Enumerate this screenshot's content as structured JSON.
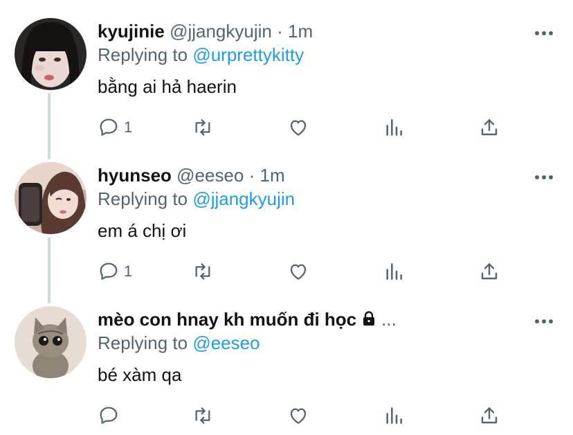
{
  "tweets": [
    {
      "name": "kyujinie",
      "handle": "@jjangkyujin",
      "dot": "·",
      "time": "1m",
      "reply_prefix": "Replying to",
      "reply_to": "@urprettykitty",
      "text": "bằng ai hả haerin",
      "reply_count": "1"
    },
    {
      "name": "hyunseo",
      "handle": "@eeseo",
      "dot": "·",
      "time": "1m",
      "reply_prefix": "Replying to",
      "reply_to": "@jjangkyujin",
      "text": "em á chị ơi",
      "reply_count": "1"
    },
    {
      "name": "mèo con hnay kh muốn đi học",
      "ellipsis": "...",
      "reply_prefix": "Replying to",
      "reply_to": "@eeseo",
      "text": "bé xàm qa",
      "reply_count": ""
    }
  ],
  "icons": {
    "reply": "reply-icon",
    "retweet": "retweet-icon",
    "like": "heart-icon",
    "views": "analytics-icon",
    "share": "share-icon",
    "more": "more-icon",
    "lock": "lock-icon"
  },
  "colors": {
    "link": "#1d9bf0",
    "secondary": "#536471",
    "thread_line": "#cfd9de"
  }
}
